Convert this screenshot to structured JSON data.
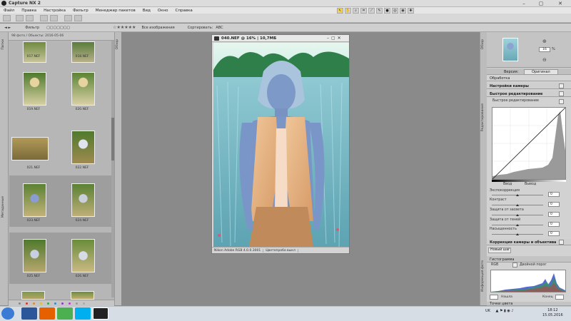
{
  "window": {
    "title": "Capture NX 2",
    "min": "–",
    "max": "▢",
    "close": "✕"
  },
  "menu": [
    "Файл",
    "Правка",
    "Настройка",
    "Фильтр",
    "Менеджер пакетов",
    "Вид",
    "Окно",
    "Справка"
  ],
  "toolbar2": {
    "filter_label": "Фильтр",
    "rating": "☆★★★★★",
    "all_images": "Все изображения",
    "sort_label": "Сортировать:",
    "sort_value": "ABC"
  },
  "browser": {
    "header": "98 фото / Обьекты: 2016-05-06",
    "tabs": [
      "Папки",
      "Метаданные"
    ],
    "side_tab": "Обзор",
    "thumbs": [
      {
        "label": "017.NEF"
      },
      {
        "label": "018.NEF"
      },
      {
        "label": "019.NEF"
      },
      {
        "label": "020.NEF"
      },
      {
        "label": "021.NEF"
      },
      {
        "label": "022.NEF"
      },
      {
        "label": "023.NEF"
      },
      {
        "label": "024.NEF"
      },
      {
        "label": "025.NEF"
      },
      {
        "label": "026.NEF"
      }
    ]
  },
  "image_window": {
    "title": "040.NEF @ 16% | 10,7МБ",
    "status_profile": "Nikon Adobe RGB 4.0.0.3001",
    "status_mode": "Цветопроба выкл"
  },
  "right_panel": {
    "zoom_value": "16",
    "zoom_unit": "%",
    "side_tabs": [
      "Обзор",
      "Редактирование",
      "Информация фото"
    ],
    "processing_label": "Обработка",
    "preset_label": "Версия:",
    "preset_value": "Оригинал",
    "camera_settings": "Настройки камеры",
    "quick_fix": "Быстрое редактирование",
    "quick_fix_sub": "Быстрое редактирование",
    "curve_in": "Ввод",
    "curve_out": "Вывод",
    "sliders": [
      {
        "label": "Экспокоррекция",
        "value": "0"
      },
      {
        "label": "Контраст",
        "value": "0"
      },
      {
        "label": "Защита от засвета",
        "value": "0"
      },
      {
        "label": "Защита от теней",
        "value": "0"
      },
      {
        "label": "Насыщенность",
        "value": "0"
      }
    ],
    "camera_lens": "Коррекция камеры и объектива",
    "new_step": "Новый шаг",
    "histogram_label": "Гистограмма",
    "hist_channel": "RGB",
    "hist_option": "Двойной порог",
    "hist_shadow": "Нашла",
    "hist_highlight": "Конец",
    "color_points": "Точки цвета"
  },
  "taskbar": {
    "lang": "UK",
    "time": "18:12",
    "date": "15.05.2016"
  },
  "colors": {
    "titlebar": "#dcdcdc",
    "workspace": "#8a8a8a",
    "panel": "#d2d2d2",
    "taskbar": "#d7dde5"
  }
}
